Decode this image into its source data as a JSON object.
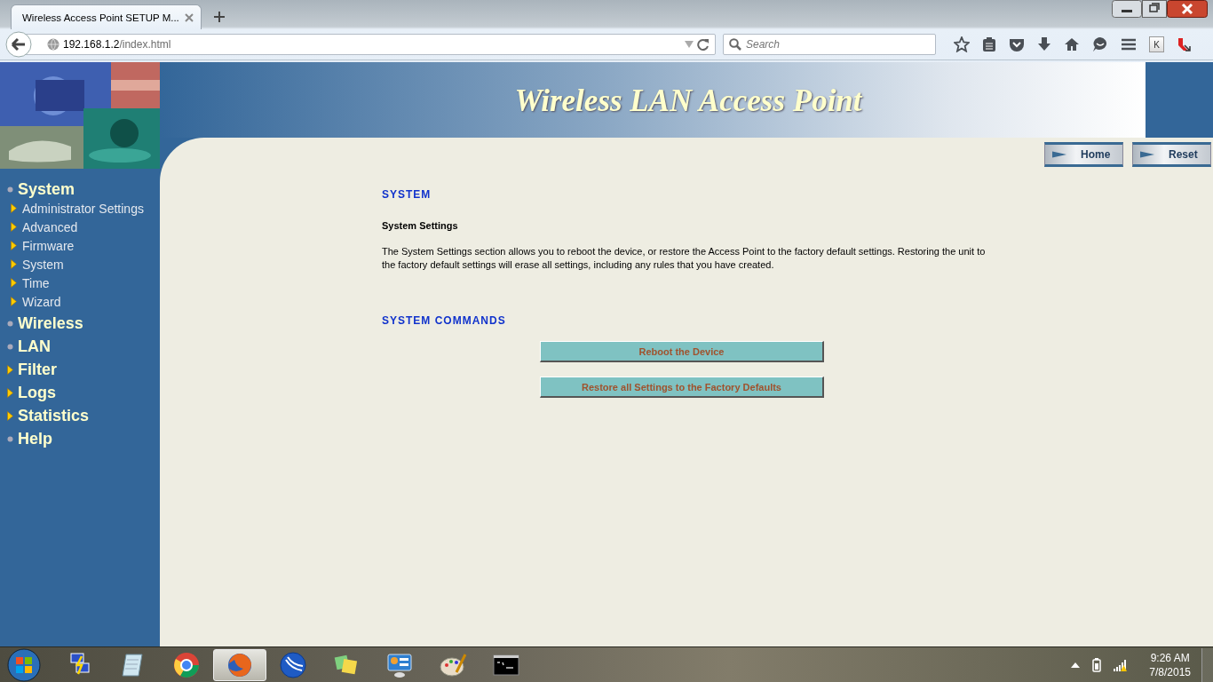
{
  "browser": {
    "tab_title": "Wireless Access Point SETUP M...",
    "url_host": "192.168.1.2",
    "url_path": "/index.html",
    "search": {
      "placeholder": "Search"
    },
    "extension_label": "K"
  },
  "banner": {
    "title": "Wireless LAN Access Point"
  },
  "nav_buttons": [
    {
      "label": "Home"
    },
    {
      "label": "Reset"
    }
  ],
  "menu": [
    {
      "label": "System",
      "kind": "dot",
      "children": [
        {
          "label": "Administrator Settings",
          "kind": "arrow"
        },
        {
          "label": "Advanced",
          "kind": "arrow"
        },
        {
          "label": "Firmware",
          "kind": "arrow"
        },
        {
          "label": "System",
          "kind": "arrow"
        },
        {
          "label": "Time",
          "kind": "arrow"
        },
        {
          "label": "Wizard",
          "kind": "arrow"
        }
      ]
    },
    {
      "label": "Wireless",
      "kind": "dot"
    },
    {
      "label": "LAN",
      "kind": "dot"
    },
    {
      "label": "Filter",
      "kind": "arrow"
    },
    {
      "label": "Logs",
      "kind": "arrow"
    },
    {
      "label": "Statistics",
      "kind": "arrow"
    },
    {
      "label": "Help",
      "kind": "dot"
    }
  ],
  "content": {
    "heading": "SYSTEM",
    "subheading": "System Settings",
    "description": "The System Settings section allows you to reboot the device, or restore the Access Point to the factory default settings. Restoring the unit to the factory default settings will erase all settings, including any rules that you have created.",
    "commands_heading": "SYSTEM COMMANDS",
    "commands": [
      {
        "label": "Reboot the Device"
      },
      {
        "label": "Restore all Settings to the Factory Defaults"
      }
    ]
  },
  "taskbar": {
    "apps": [
      {
        "kind": "network",
        "selected": false
      },
      {
        "kind": "notepad",
        "selected": false
      },
      {
        "kind": "globe",
        "selected": false
      },
      {
        "kind": "fox",
        "selected": true
      },
      {
        "kind": "circle",
        "selected": false
      },
      {
        "kind": "squares",
        "selected": false
      },
      {
        "kind": "panel",
        "selected": false
      },
      {
        "kind": "palette",
        "selected": false
      },
      {
        "kind": "terminal",
        "selected": false
      }
    ],
    "time": "9:26 AM",
    "date": "7/8/2015"
  }
}
